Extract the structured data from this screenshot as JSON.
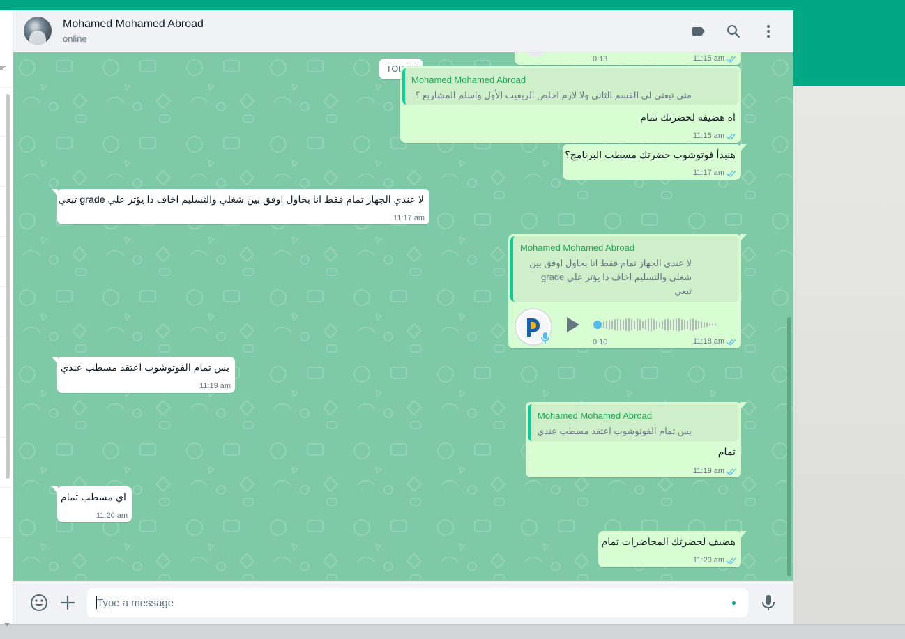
{
  "contact": {
    "name": "Mohamed Mohamed Abroad",
    "status": "online"
  },
  "date_chip": "TODAY",
  "colors": {
    "brand": "#00a884",
    "outgoing": "#d9fdd3",
    "incoming": "#ffffff",
    "ticks": "#53bdeb",
    "quote_name": "#1fa855"
  },
  "icons": {
    "label": "label-icon",
    "search": "search-icon",
    "menu": "menu-icon",
    "emoji": "emoji-icon",
    "attach": "plus-icon",
    "mic": "mic-icon",
    "play": "play-icon"
  },
  "messages": {
    "top_partial": {
      "duration": "0:13",
      "time": "11:15 am"
    },
    "m1": {
      "quote_name": "Mohamed Mohamed Abroad",
      "quote_text": "متي تبعتي لي القسم الثاني ولا لازم اخلص الريفيت الأول واسلم المشاريع ؟",
      "text": "اه هضيفه لحضرتك تمام",
      "time": "11:15 am"
    },
    "m2": {
      "text": "هنبدأ فوتوشوب حضرتك مسطب البرنامج؟",
      "time": "11:17 am"
    },
    "m3": {
      "text": "لا عندي الجهاز تمام فقط انا بحاول اوفق بين شغلي والتسليم اخاف دا يؤثر علي grade تبعي",
      "time": "11:17 am"
    },
    "m4": {
      "quote_name": "Mohamed Mohamed Abroad",
      "quote_line1": "لا عندي الجهاز تمام فقط انا بحاول اوفق بين",
      "quote_line2": "شغلي والتسليم اخاف دا يؤثر علي grade",
      "quote_line3": "تبعي",
      "duration": "0:10",
      "time": "11:18 am",
      "progress": 0.0
    },
    "m5": {
      "text": "بس تمام الفوتوشوب اعتقد مسطب عندي",
      "time": "11:19 am"
    },
    "m6": {
      "quote_name": "Mohamed Mohamed Abroad",
      "quote_text": "بس تمام الفوتوشوب اعتقد مسطب عندي",
      "text": "تمام",
      "time": "11:19 am"
    },
    "m7": {
      "text": "اي مسطب تمام",
      "time": "11:20 am"
    },
    "m8": {
      "text": "هضيف لحضرتك المحاضرات تمام",
      "time": "11:20 am"
    }
  },
  "compose": {
    "placeholder": "Type a message",
    "value": ""
  }
}
